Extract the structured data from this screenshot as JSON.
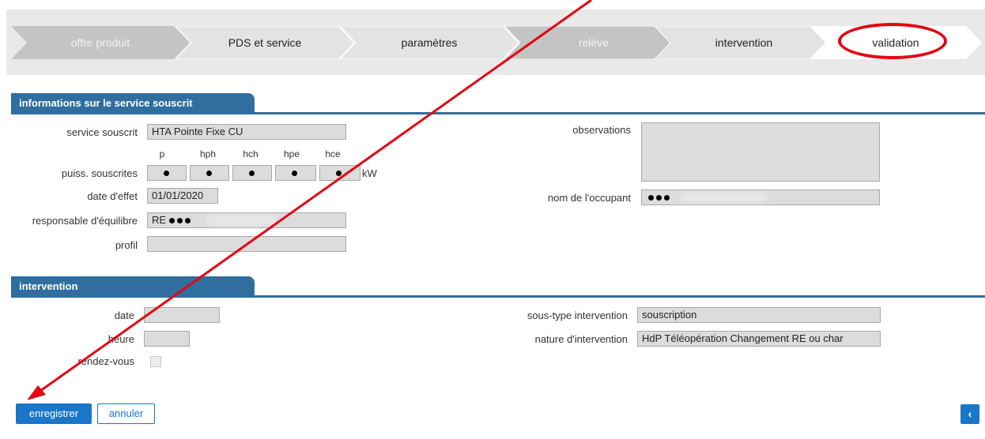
{
  "wizard": {
    "steps": [
      {
        "label": "offre produit"
      },
      {
        "label": "PDS et service"
      },
      {
        "label": "paramètres"
      },
      {
        "label": "relève"
      },
      {
        "label": "intervention"
      },
      {
        "label": "validation"
      }
    ]
  },
  "service_section": {
    "title": "informations sur le service souscrit",
    "service_souscrit_label": "service souscrit",
    "service_souscrit_value": "HTA Pointe Fixe CU",
    "power_columns": [
      "p",
      "hph",
      "hch",
      "hpe",
      "hce"
    ],
    "puiss_label": "puiss. souscrites",
    "power_unit": "kW",
    "date_effet_label": "date d'effet",
    "date_effet_value": "01/01/2020",
    "responsable_label": "responsable d'équilibre",
    "responsable_prefix": "RE",
    "profil_label": "profil",
    "observations_label": "observations",
    "occupant_label": "nom de l'occupant"
  },
  "intervention_section": {
    "title": "intervention",
    "date_label": "date",
    "heure_label": "heure",
    "rdv_label": "rendez-vous",
    "sous_type_label": "sous-type intervention",
    "sous_type_value": "souscription",
    "nature_label": "nature d'intervention",
    "nature_value": "HdP Téléopération Changement RE ou char"
  },
  "actions": {
    "save_label": "enregistrer",
    "cancel_label": "annuler",
    "collapse_icon": "chevron-left-icon"
  },
  "colors": {
    "accent": "#1a76c9",
    "section": "#2f6e9e",
    "annotation": "#e30613",
    "step_faded": "#c4c4c4",
    "step_active": "#e3e3e3"
  }
}
